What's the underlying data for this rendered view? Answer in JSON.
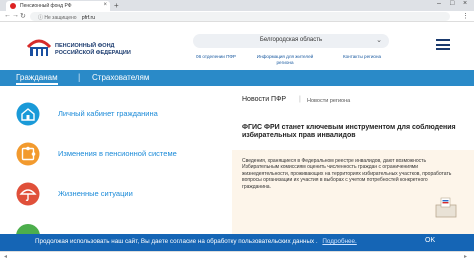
{
  "browser": {
    "tab_title": "Пенсионный фонд РФ",
    "tab_close": "×",
    "new_tab": "+",
    "minimize": "–",
    "maximize": "□",
    "close": "×",
    "back": "←",
    "forward": "→",
    "reload": "↻",
    "security_label": "ⓘ Не защищено",
    "url": "pfrf.ru",
    "menu": "⋮"
  },
  "header": {
    "logo_text": "ПЕНСИОННЫЙ ФОНД РОССИЙСКОЙ ФЕДЕРАЦИИ",
    "region_selected": "Белгородская область",
    "region_chevron": "⌄",
    "links": [
      {
        "label": "06 отделении ПФР"
      },
      {
        "label": "Информация для жителей региона"
      },
      {
        "label": "Контакты региона"
      }
    ]
  },
  "nav": {
    "items": [
      {
        "label": "Гражданам"
      },
      {
        "label": "Страхователям"
      }
    ],
    "separator": "|"
  },
  "left_menu": {
    "items": [
      {
        "label": "Личный кабинет гражданина",
        "color": "#1a9ad8"
      },
      {
        "label": "Изменения в пенсионной системе",
        "color": "#f29a2e"
      },
      {
        "label": "Жизненные ситуации",
        "color": "#e0503a"
      }
    ]
  },
  "news": {
    "tab_active": "Новости ПФР",
    "tab_sep": "|",
    "tab_other": "Новости региона",
    "headline": "ФГИС ФРИ станет ключевым инструментом для соблюдения избирательных прав инвалидов",
    "body": "Сведения, хранящиеся в Федеральном реестре инвалидов, дают возможность Избирательным комиссиям оценить численность граждан с ограничениями жизнедеятельности, проживающих на территориях избирательных участков, проработать вопросы организации их участия в выборах с учетом потребностей конкретного гражданина."
  },
  "cookie": {
    "text": "Продолжая использовать наш сайт, Вы даете согласие на обработку пользовательских данных .",
    "link": "Подробнее.",
    "ok": "OK"
  },
  "colors": {
    "nav_bg": "#2a8ac8",
    "cookie_bg": "#1565b5",
    "news_box_bg": "#fdf5ea",
    "brand_blue": "#1a3a6e"
  }
}
